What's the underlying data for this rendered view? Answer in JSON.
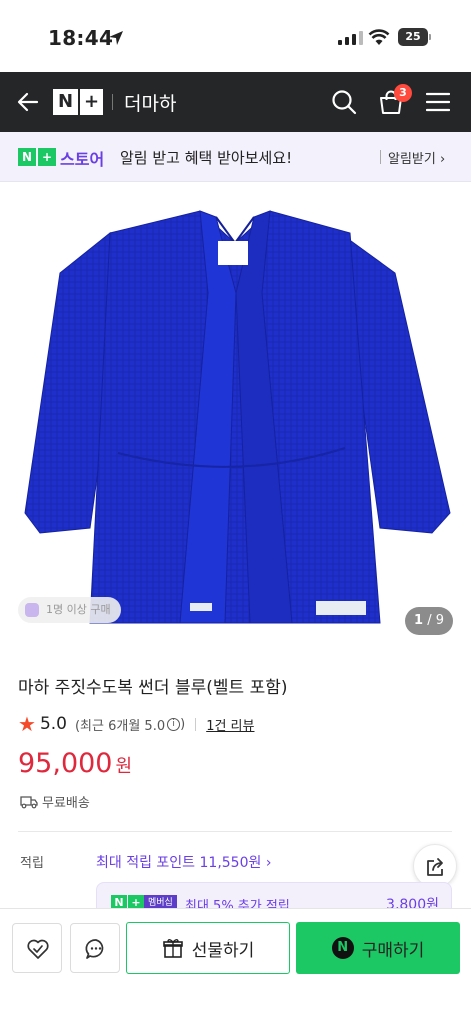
{
  "status_bar": {
    "time": "18:44",
    "battery": "25"
  },
  "header": {
    "brand": "더마하",
    "cart_count": "3"
  },
  "promo": {
    "brand": "스토어",
    "message": "알림 받고 혜택 받아보세요!",
    "subscribe_label": "알림받기"
  },
  "product": {
    "buyer_badge": "1명 이상 구매",
    "image_index": "1",
    "image_total": "/ 9",
    "title": "마하 주짓수도복 썬더 블루(벨트 포함)",
    "rating": "5.0",
    "recent_rating": "(최근 6개월 5.0",
    "recent_rating_close": ")",
    "reviews": "1건 리뷰",
    "price": "95,000",
    "currency": "원",
    "shipping": "무료배송",
    "gi_color": "#1f2fcb"
  },
  "points": {
    "label": "적립",
    "max_points": "최대 적립 포인트 11,550원",
    "membership_badge": "멤버십",
    "membership_text": "최대 5% 추가 적립",
    "membership_value": "3,800원"
  },
  "bottom_bar": {
    "gift_label": "선물하기",
    "buy_label": "구매하기"
  },
  "colors": {
    "accent_green": "#1cc864",
    "price_red": "#e0283d",
    "purple": "#6b3fe6",
    "header_dark": "#252628"
  }
}
